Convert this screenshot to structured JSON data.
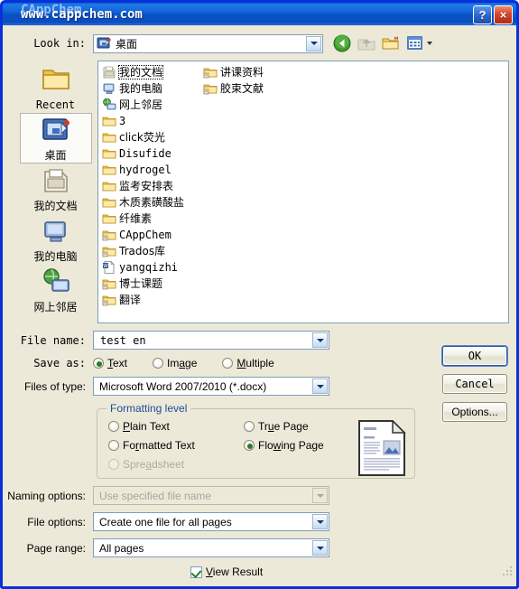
{
  "window": {
    "title": "www.cappchem.com",
    "watermark": "CAppChem",
    "help_button": "?",
    "close_button": "×"
  },
  "toolbar": {
    "lookin_label": "Look in:",
    "lookin_value": "桌面",
    "back_icon": "back-arrow-icon",
    "up_icon": "up-one-level-icon",
    "newfolder_icon": "new-folder-icon",
    "views_icon": "views-icon"
  },
  "places": [
    {
      "label": "Recent",
      "icon": "recent-folder-icon",
      "selected": false,
      "cjk": false
    },
    {
      "label": "桌面",
      "icon": "desktop-icon",
      "selected": true,
      "cjk": true
    },
    {
      "label": "我的文档",
      "icon": "my-documents-icon",
      "selected": false,
      "cjk": true
    },
    {
      "label": "我的电脑",
      "icon": "my-computer-icon",
      "selected": false,
      "cjk": true
    },
    {
      "label": "网上邻居",
      "icon": "network-places-icon",
      "selected": false,
      "cjk": true
    }
  ],
  "files": [
    {
      "name": "我的文档",
      "icon": "my-documents-icon",
      "focused": true,
      "cjk": true
    },
    {
      "name": "我的电脑",
      "icon": "my-computer-icon",
      "focused": false,
      "cjk": true
    },
    {
      "name": "网上邻居",
      "icon": "network-places-icon",
      "focused": false,
      "cjk": true
    },
    {
      "name": "3",
      "icon": "folder-icon",
      "focused": false,
      "cjk": false
    },
    {
      "name": "click荧光",
      "icon": "folder-icon",
      "focused": false,
      "cjk": true
    },
    {
      "name": "Disufide",
      "icon": "folder-icon",
      "focused": false,
      "cjk": false
    },
    {
      "name": "hydrogel",
      "icon": "folder-icon",
      "focused": false,
      "cjk": false
    },
    {
      "name": "监考安排表",
      "icon": "folder-icon",
      "focused": false,
      "cjk": true
    },
    {
      "name": "木质素磺酸盐",
      "icon": "folder-icon",
      "focused": false,
      "cjk": true
    },
    {
      "name": "纤维素",
      "icon": "folder-icon",
      "focused": false,
      "cjk": true
    },
    {
      "name": "CAppChem",
      "icon": "shared-folder-icon",
      "focused": false,
      "cjk": false
    },
    {
      "name": "Trados库",
      "icon": "shared-folder-icon",
      "focused": false,
      "cjk": true
    },
    {
      "name": "yangqizhi",
      "icon": "word-document-icon",
      "focused": false,
      "cjk": false
    },
    {
      "name": "博士课题",
      "icon": "shared-folder-icon",
      "focused": false,
      "cjk": true
    },
    {
      "name": "翻译",
      "icon": "shared-folder-icon",
      "focused": false,
      "cjk": true
    },
    {
      "name": "讲课资料",
      "icon": "shared-folder-icon",
      "focused": false,
      "cjk": true
    },
    {
      "name": "胶束文献",
      "icon": "shared-folder-icon",
      "focused": false,
      "cjk": true
    }
  ],
  "form": {
    "filename_label": "File name:",
    "filename_value": "test en",
    "saveas_label": "Save as:",
    "saveas_options": [
      {
        "label_pre": "",
        "label_acc": "T",
        "label_post": "ext",
        "selected": true
      },
      {
        "label_pre": "Im",
        "label_acc": "a",
        "label_post": "ge",
        "selected": false
      },
      {
        "label_pre": "",
        "label_acc": "M",
        "label_post": "ultiple",
        "selected": false
      }
    ],
    "filetype_label": "Files of type:",
    "filetype_value": "Microsoft Word 2007/2010 (*.docx)",
    "ok_label": "OK",
    "cancel_label": "Cancel",
    "options_label": "Options..."
  },
  "formatting": {
    "title": "Formatting level",
    "col1": [
      {
        "pre": "",
        "acc": "P",
        "post": "lain Text",
        "selected": false,
        "disabled": false
      },
      {
        "pre": "Fo",
        "acc": "r",
        "post": "matted Text",
        "selected": false,
        "disabled": false
      },
      {
        "pre": "Spre",
        "acc": "a",
        "post": "dsheet",
        "selected": false,
        "disabled": true
      }
    ],
    "col2": [
      {
        "pre": "Tr",
        "acc": "u",
        "post": "e Page",
        "selected": false,
        "disabled": false
      },
      {
        "pre": "Flo",
        "acc": "w",
        "post": "ing Page",
        "selected": true,
        "disabled": false
      }
    ],
    "preview_icon": "document-preview-thumbnail"
  },
  "bottom": {
    "naming_label": "Naming options:",
    "naming_value": "Use specified file name",
    "naming_disabled": true,
    "fileoptions_label": "File options:",
    "fileoptions_value": "Create one file for all pages",
    "pagerange_label": "Page range:",
    "pagerange_value": "All pages",
    "viewresult_pre": "",
    "viewresult_acc": "V",
    "viewresult_post": "iew Result",
    "viewresult_checked": true
  },
  "colors": {
    "dialog_bg": "#ECE9D8",
    "title_blue": "#0831D9",
    "accent_blue": "#1F4E9C",
    "field_border": "#7F9DB9",
    "radio_green": "#2A7A2A"
  }
}
